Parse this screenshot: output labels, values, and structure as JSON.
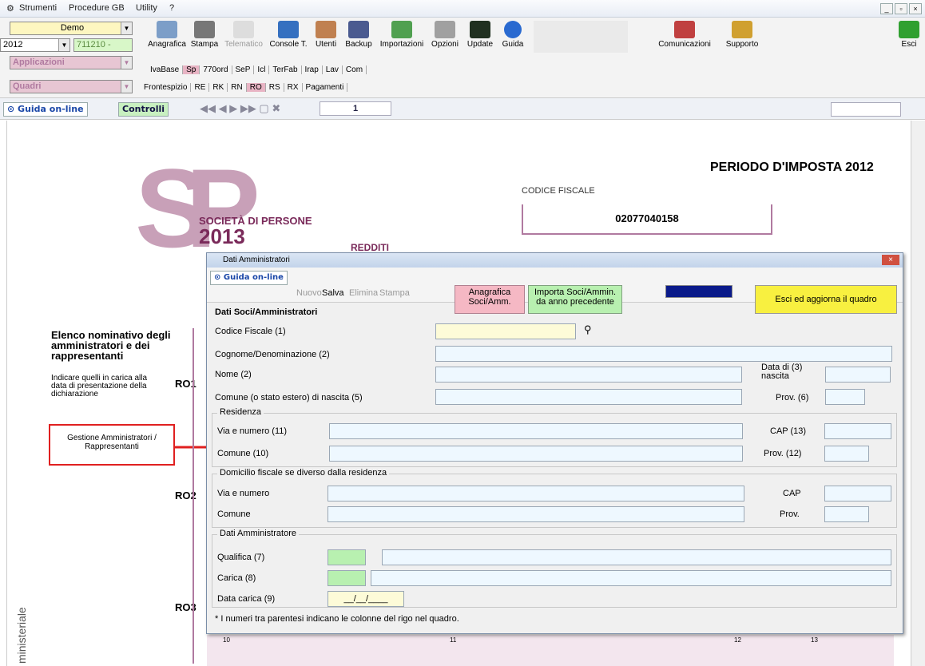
{
  "menu": {
    "items": [
      "Strumenti",
      "Procedure GB",
      "Utility",
      "?"
    ]
  },
  "toolbar": {
    "company": "Demo",
    "year": "2012",
    "code": "711210 -",
    "app": "Applicazioni",
    "quadri": "Quadri",
    "buttons": [
      "Anagrafica",
      "Stampa",
      "Telematico",
      "Console T.",
      "Utenti",
      "Backup",
      "Importazioni",
      "Opzioni",
      "Update",
      "Guida"
    ],
    "comm": "Comunicazioni",
    "support": "Supporto",
    "exit": "Esci",
    "tabs1": [
      "IvaBase",
      "Sp",
      "770ord",
      "SeP",
      "Icl",
      "TerFab",
      "Irap",
      "Lav",
      "Com"
    ],
    "tabs2": [
      "Frontespizio",
      "RE",
      "RK",
      "RN",
      "RO",
      "RS",
      "RX",
      "Pagamenti"
    ]
  },
  "nav": {
    "guide": "Guida on-line",
    "controls": "Controlli",
    "page": "1"
  },
  "doc": {
    "period": "PERIODO D'IMPOSTA 2012",
    "cf_label": "CODICE FISCALE",
    "cf_value": "02077040158",
    "sp": "SP",
    "soc": "SOCIETÀ DI PERSONE",
    "year": "2013",
    "redditi": "REDDITI",
    "elenco": "Elenco nominativo degli amministratori e dei rappresentanti",
    "indicare": "Indicare quelli in carica alla data di presentazione della dichiarazione",
    "gestione": "Gestione Amministratori / Rappresentanti",
    "ro1": "RO1",
    "ro2": "RO2",
    "ro3": "RO3",
    "side": "ministeriale",
    "col10": "10",
    "col11": "11",
    "col12": "12",
    "col13": "13"
  },
  "dialog": {
    "title": "Dati Amministratori",
    "guide": "Guida on-line",
    "nuovo": "Nuovo",
    "salva": "Salva",
    "elimina": "Elimina",
    "stampa": "Stampa",
    "anagrafica": "Anagrafica Soci/Amm.",
    "importa": "Importa Soci/Ammin. da anno precedente",
    "esci": "Esci ed aggiorna il quadro",
    "section": "Dati Soci/Amministratori",
    "cf": "Codice Fiscale (1)",
    "cognome": "Cognome/Denominazione (2)",
    "nome": "Nome (2)",
    "datanascita": "Data di (3) nascita",
    "comune_nascita": "Comune (o stato estero) di nascita (5)",
    "prov6": "Prov. (6)",
    "residenza": "Residenza",
    "via11": "Via e numero (11)",
    "cap13": "CAP (13)",
    "comune10": "Comune (10)",
    "prov12": "Prov. (12)",
    "domicilio": "Domicilio fiscale se diverso dalla residenza",
    "via": "Via e numero",
    "cap": "CAP",
    "comune": "Comune",
    "prov": "Prov.",
    "dati_amm": "Dati Amministratore",
    "qualifica": "Qualifica (7)",
    "carica": "Carica (8)",
    "datacarica": "Data carica (9)",
    "date_ph": "__/__/____",
    "note": "* I numeri tra parentesi indicano le colonne del rigo nel quadro."
  },
  "colors": {
    "accent": "#b07aa0",
    "red": "#e02020"
  }
}
